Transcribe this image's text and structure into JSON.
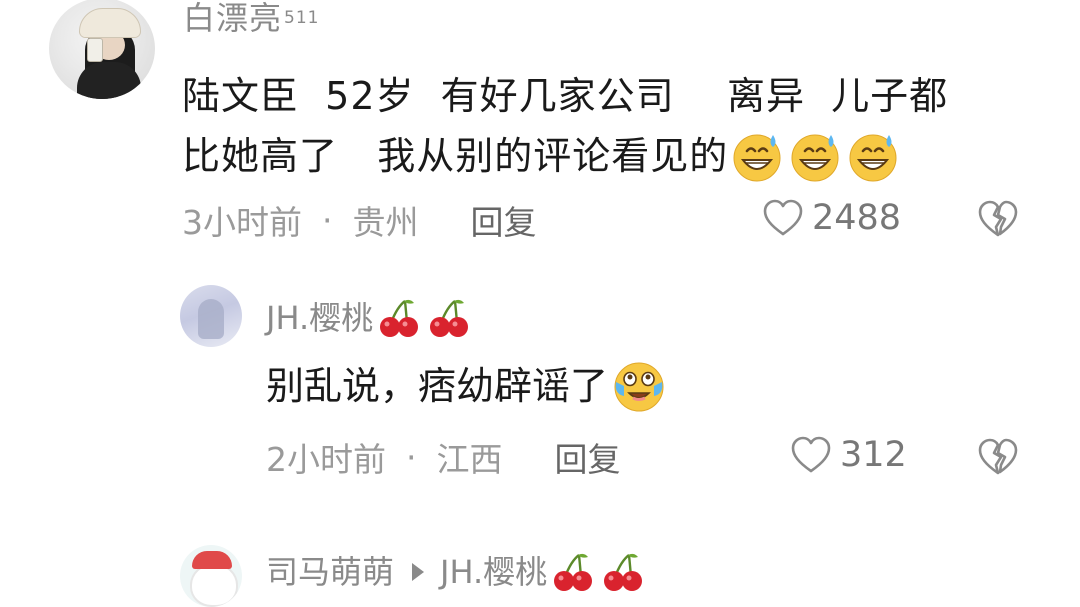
{
  "comment": {
    "username": "白漂亮",
    "level": "511",
    "text_line1": "陆文臣  52岁  有好几家公司    离异  儿子都",
    "text_line2": "比她高了   我从别的评论看见的",
    "emoji": "grinning-sweat",
    "emoji_count": 3,
    "time": "3小时前",
    "separator": "·",
    "location": "贵州",
    "reply_label": "回复",
    "likes": "2488",
    "icons": [
      "heart-outline-icon",
      "broken-heart-icon"
    ]
  },
  "replies": [
    {
      "username": "JH.樱桃",
      "name_emoji": "cherry",
      "name_emoji_count": 2,
      "text": "别乱说，痞幼辟谣了",
      "text_emoji": "loudly-crying-laughing",
      "time": "2小时前",
      "separator": "·",
      "location": "江西",
      "reply_label": "回复",
      "likes": "312"
    },
    {
      "username": "司马萌萌",
      "reply_to": "JH.樱桃",
      "name_emoji": "cherry",
      "name_emoji_count": 2
    }
  ],
  "colors": {
    "meta_gray": "#9a9a9a",
    "name_gray": "#8a8a8a",
    "text": "#1a1a1a",
    "emoji_yellow": "#f7c843",
    "cherry_red": "#d9232e"
  }
}
